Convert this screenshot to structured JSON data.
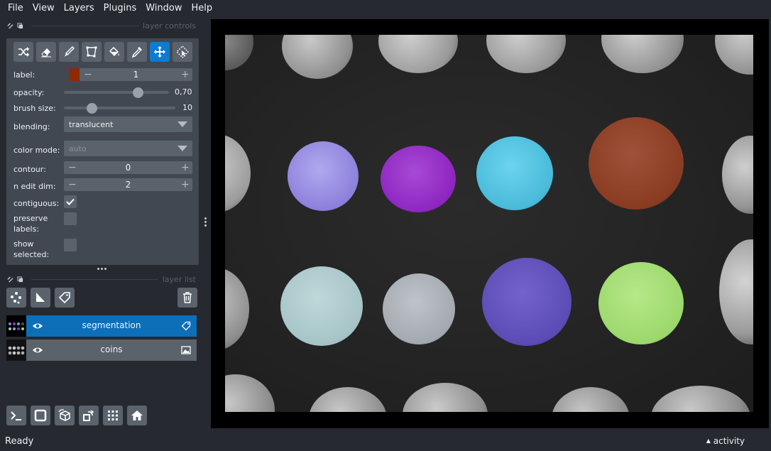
{
  "menu": [
    "File",
    "View",
    "Layers",
    "Plugins",
    "Window",
    "Help"
  ],
  "layer_controls": {
    "title": "layer controls",
    "tools": [
      "shuffle-icon",
      "erase-icon",
      "paint-icon",
      "polygon-icon",
      "fill-icon",
      "picker-icon",
      "pan-zoom-icon",
      "transform-icon"
    ],
    "active_tool": "pan-zoom-icon",
    "label": {
      "caption": "label:",
      "value": "1",
      "color": "#8b2a06"
    },
    "opacity": {
      "caption": "opacity:",
      "value": "0,70",
      "fraction": 0.7
    },
    "brush_size": {
      "caption": "brush size:",
      "value": "10",
      "fraction": 0.25
    },
    "blending": {
      "caption": "blending:",
      "value": "translucent"
    },
    "color_mode": {
      "caption": "color mode:",
      "value": "auto"
    },
    "contour": {
      "caption": "contour:",
      "value": "0"
    },
    "n_edit_dim": {
      "caption": "n edit dim:",
      "value": "2"
    },
    "contiguous": {
      "caption": "contiguous:",
      "checked": true
    },
    "preserve_labels": {
      "caption": "preserve labels:",
      "checked": false
    },
    "show_selected": {
      "caption": "show selected:",
      "checked": false
    }
  },
  "layer_list": {
    "title": "layer list",
    "layers": [
      {
        "name": "segmentation",
        "selected": true,
        "type_icon": "labels-icon"
      },
      {
        "name": "coins",
        "selected": false,
        "type_icon": "image-icon"
      }
    ]
  },
  "status": {
    "text": "Ready",
    "activity": "activity"
  },
  "colors": {
    "accent": "#0d7bcf",
    "panel": "#414851",
    "background": "#262930"
  }
}
